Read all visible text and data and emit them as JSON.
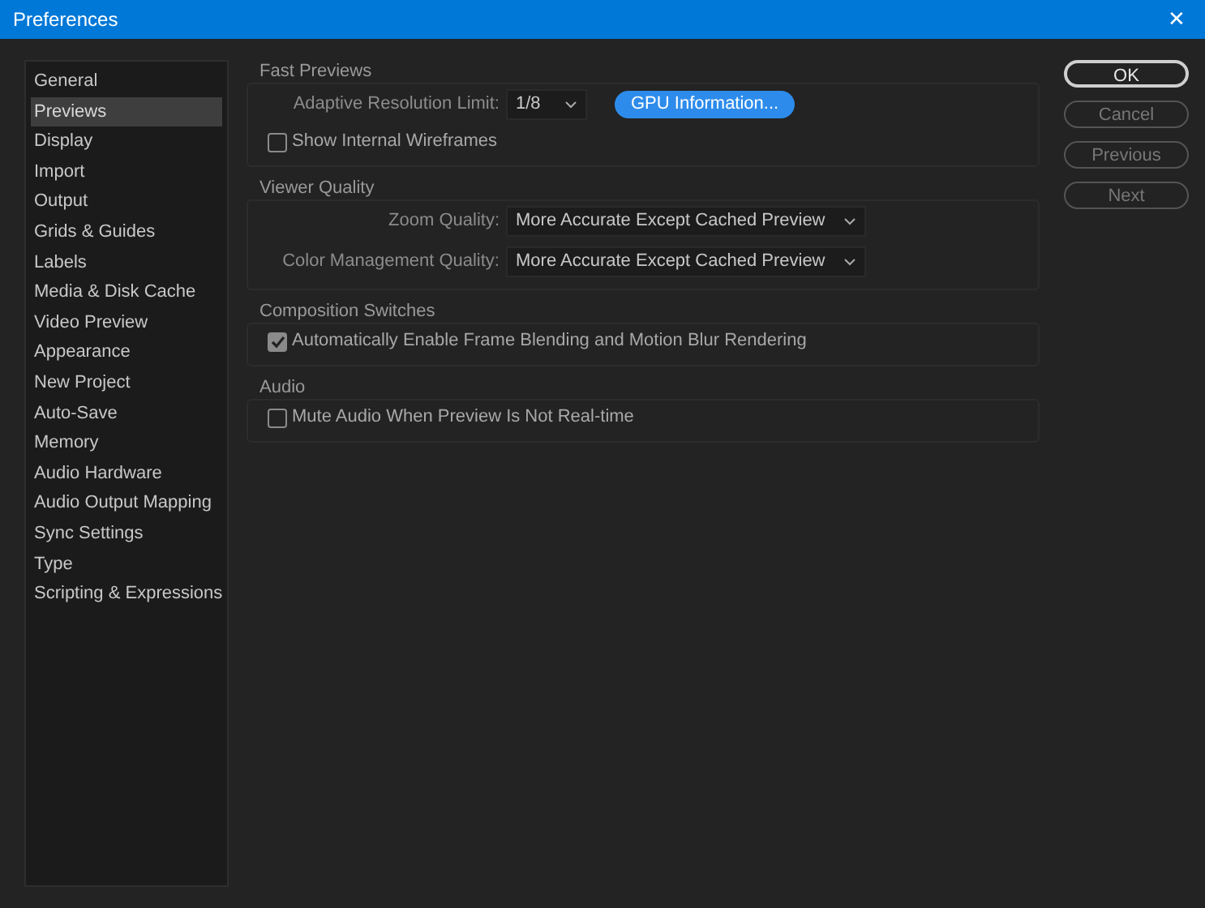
{
  "window": {
    "title": "Preferences",
    "close": "✕"
  },
  "sidebar": {
    "items": [
      {
        "label": "General",
        "selected": false
      },
      {
        "label": "Previews",
        "selected": true
      },
      {
        "label": "Display",
        "selected": false
      },
      {
        "label": "Import",
        "selected": false
      },
      {
        "label": "Output",
        "selected": false
      },
      {
        "label": "Grids & Guides",
        "selected": false
      },
      {
        "label": "Labels",
        "selected": false
      },
      {
        "label": "Media & Disk Cache",
        "selected": false
      },
      {
        "label": "Video Preview",
        "selected": false
      },
      {
        "label": "Appearance",
        "selected": false
      },
      {
        "label": "New Project",
        "selected": false
      },
      {
        "label": "Auto-Save",
        "selected": false
      },
      {
        "label": "Memory",
        "selected": false
      },
      {
        "label": "Audio Hardware",
        "selected": false
      },
      {
        "label": "Audio Output Mapping",
        "selected": false
      },
      {
        "label": "Sync Settings",
        "selected": false
      },
      {
        "label": "Type",
        "selected": false
      },
      {
        "label": "Scripting & Expressions",
        "selected": false
      }
    ]
  },
  "sections": [
    {
      "title": "Fast Previews",
      "rows": [
        {
          "kind": "select",
          "label": "Adaptive Resolution Limit:",
          "value": "1/8",
          "button": "GPU Information..."
        },
        {
          "kind": "checkbox",
          "label": "Show Internal Wireframes",
          "checked": false
        }
      ]
    },
    {
      "title": "Viewer Quality",
      "rows": [
        {
          "kind": "select",
          "label": "Zoom Quality:",
          "value": "More Accurate Except Cached Preview"
        },
        {
          "kind": "select",
          "label": "Color Management Quality:",
          "value": "More Accurate Except Cached Preview"
        }
      ]
    },
    {
      "title": "Composition Switches",
      "rows": [
        {
          "kind": "checkbox",
          "label": "Automatically Enable Frame Blending and Motion Blur Rendering",
          "checked": true
        }
      ]
    },
    {
      "title": "Audio",
      "rows": [
        {
          "kind": "checkbox",
          "label": "Mute Audio When Preview Is Not Real-time",
          "checked": false
        }
      ]
    }
  ],
  "buttons": [
    {
      "label": "OK",
      "disabled": false
    },
    {
      "label": "Cancel",
      "disabled": true
    },
    {
      "label": "Previous",
      "disabled": true
    },
    {
      "label": "Next",
      "disabled": true
    }
  ]
}
